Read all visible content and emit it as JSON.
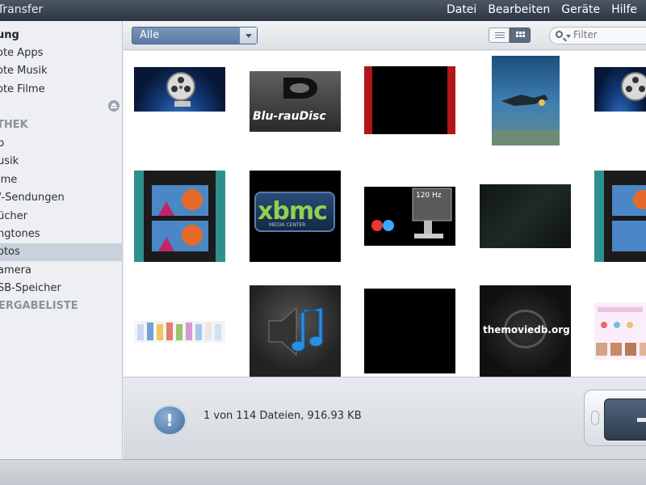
{
  "window": {
    "title": "iTransfer"
  },
  "menu": [
    "Datei",
    "Bearbeiten",
    "Geräte",
    "Hilfe"
  ],
  "sidebar": {
    "items": [
      {
        "label": "ung",
        "bold": true
      },
      {
        "label": "ote Apps"
      },
      {
        "label": "ote Musik"
      },
      {
        "label": "ote Filme"
      }
    ],
    "library_heading": "THEK",
    "library_items": [
      {
        "label": "p"
      },
      {
        "label": "usik"
      },
      {
        "label": "lme"
      },
      {
        "label": "/-Sendungen"
      },
      {
        "label": "ücher"
      },
      {
        "label": "ngtones"
      },
      {
        "label": "otos",
        "selected": true
      },
      {
        "label": "amera"
      },
      {
        "label": "SB-Speicher"
      }
    ],
    "playlist_heading": "ERGABELISTE"
  },
  "toolbar": {
    "filter_value": "Alle",
    "search_placeholder": "Filter"
  },
  "thumbnails": [
    {
      "name": "film-reel-image"
    },
    {
      "name": "bluray-disc-image",
      "text": "Blu-rauDisc"
    },
    {
      "name": "red-border-image"
    },
    {
      "name": "diver-underwater-image"
    },
    {
      "name": "film-reel-image-2"
    },
    {
      "name": "filmstrip-balloon-image"
    },
    {
      "name": "xbmc-logo-image",
      "text": "xbmc",
      "subtext": "MEDIA CENTER"
    },
    {
      "name": "3d-monitor-image",
      "text": "120 Hz"
    },
    {
      "name": "dark-green-image"
    },
    {
      "name": "filmstrip-balloon-image-2"
    },
    {
      "name": "colored-bars-image"
    },
    {
      "name": "itunes-speaker-image"
    },
    {
      "name": "black-image"
    },
    {
      "name": "themoviedb-logo-image",
      "text": "themoviedb.org"
    },
    {
      "name": "kids-chart-image"
    }
  ],
  "status": {
    "text": "1 von 114 Dateien, 916.93 KB"
  }
}
